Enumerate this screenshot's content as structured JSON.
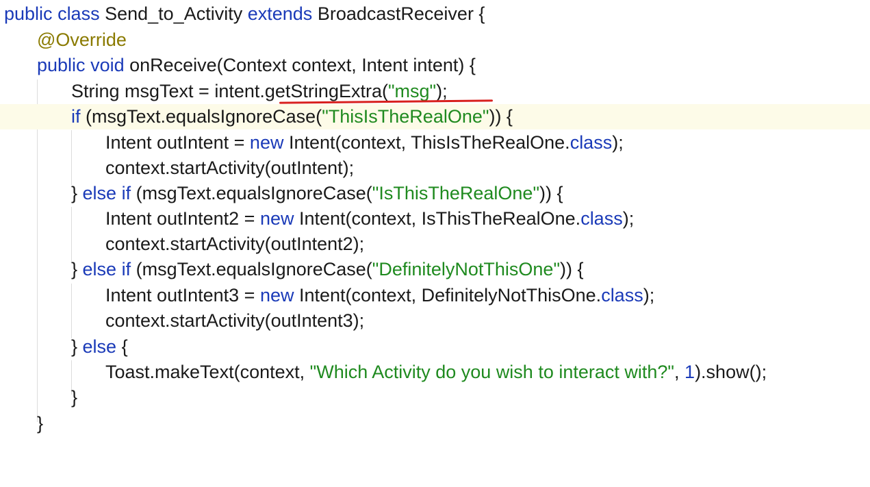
{
  "code": {
    "line1": {
      "kw1": "public",
      "kw2": "class",
      "name": "Send_to_Activity",
      "kw3": "extends",
      "parent": "BroadcastReceiver {"
    },
    "line2": {
      "annotation": "@Override"
    },
    "line3": {
      "kw1": "public",
      "kw2": "void",
      "rest": "onReceive(Context context, Intent intent) {"
    },
    "line4": {
      "a": "String msgText = intent.",
      "method": "getStringExtra(",
      "str": "\"msg\"",
      "b": ");"
    },
    "line5": {
      "kw": "if",
      "a": "(msgText.equalsIgnoreCase(",
      "str": "\"ThisIsTheRealOne\"",
      "b": ")) {"
    },
    "line6": {
      "a": "Intent outIntent = ",
      "kw": "new",
      "b": "Intent(context, ThisIsTheRealOne.",
      "kw2": "class",
      "c": ");"
    },
    "line7": {
      "a": "context.startActivity(outIntent);"
    },
    "line8": {
      "a": "} ",
      "kw1": "else",
      "kw2": "if",
      "b": "(msgText.equalsIgnoreCase(",
      "str": "\"IsThisTheRealOne\"",
      "c": ")) {"
    },
    "line9": {
      "a": "Intent outIntent2 = ",
      "kw": "new",
      "b": "Intent(context, IsThisTheRealOne.",
      "kw2": "class",
      "c": ");"
    },
    "line10": {
      "a": "context.startActivity(outIntent2);"
    },
    "line11": {
      "a": "} ",
      "kw1": "else",
      "kw2": "if",
      "b": "(msgText.equalsIgnoreCase(",
      "str": "\"DefinitelyNotThisOne\"",
      "c": ")) {"
    },
    "line12": {
      "a": "Intent outIntent3 = ",
      "kw": "new",
      "b": "Intent(context, DefinitelyNotThisOne.",
      "kw2": "class",
      "c": ");"
    },
    "line13": {
      "a": "context.startActivity(outIntent3);"
    },
    "line14": {
      "a": "} ",
      "kw": "else",
      "b": " {"
    },
    "line15": {
      "a": "Toast.makeText(context, ",
      "str": "\"Which Activity do you wish to interact with?\"",
      "b": ", ",
      "num": "1",
      "c": ").show();"
    },
    "line16": {
      "a": "}"
    },
    "line17": {
      "a": "}"
    }
  },
  "colors": {
    "keyword": "#1a3ab8",
    "string": "#1f8a1f",
    "annotation": "#8a7a00",
    "current_line": "#fdfbe8",
    "red_underline": "#d8201e"
  }
}
